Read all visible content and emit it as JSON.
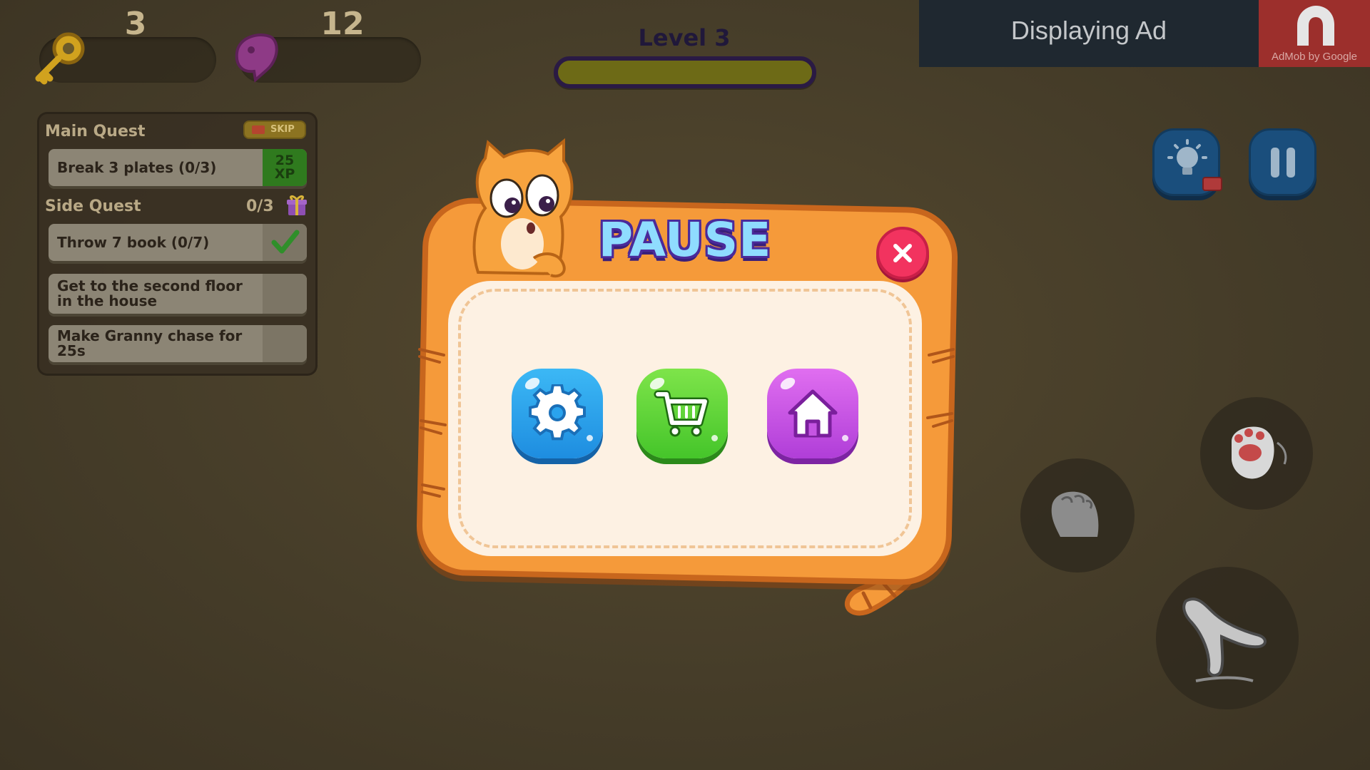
{
  "hud": {
    "keys_count": "3",
    "fish_count": "12",
    "level_label": "Level 3",
    "level_progress": 0
  },
  "ad": {
    "text": "Displaying Ad",
    "sub": "AdMob by Google"
  },
  "quests": {
    "main_title": "Main Quest",
    "skip_label": "SKIP",
    "main_item": {
      "label": "Break 3 plates (0/3)",
      "xp_value": "25",
      "xp_unit": "XP"
    },
    "side_title": "Side Quest",
    "side_progress": "0/3",
    "side_items": [
      {
        "label": "Throw 7 book (0/7)",
        "done": true
      },
      {
        "label": "Get to the second floor in the house",
        "done": false
      },
      {
        "label": "Make Granny chase for 25s",
        "done": false
      }
    ]
  },
  "pause_dialog": {
    "title": "PAUSE",
    "buttons": [
      {
        "icon": "gear-icon"
      },
      {
        "icon": "cart-icon"
      },
      {
        "icon": "home-icon"
      }
    ]
  },
  "colors": {
    "dialog_orange": "#f59a3a",
    "title_blue": "#8fdcff",
    "close_red": "#f2335f",
    "settings_blue": "#2aa3ee",
    "shop_green": "#5ed43a",
    "home_purple": "#c555e3"
  }
}
